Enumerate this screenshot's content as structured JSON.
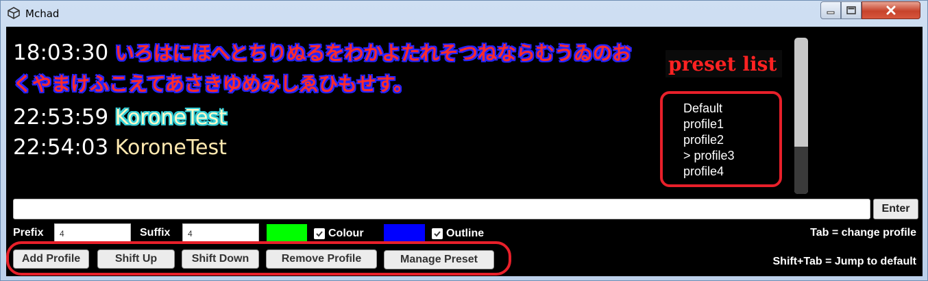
{
  "window": {
    "title": "Mchad"
  },
  "chat": [
    {
      "time": "18:03:30",
      "text": "いろはにほへとちりぬるをわかよたれそつねならむうゐのお",
      "style": "red"
    },
    {
      "time": "",
      "text": "くやまけふこえてあさきゆめみしゑひもせす。",
      "style": "red"
    },
    {
      "time": "22:53:59",
      "text": "KoroneTest",
      "style": "cyan"
    },
    {
      "time": "22:54:03",
      "text": "KoroneTest",
      "style": "plain"
    }
  ],
  "preset_panel": {
    "title": "preset list",
    "items": [
      "Default",
      "profile1",
      "profile2",
      "> profile3",
      "profile4"
    ]
  },
  "input": {
    "value": "",
    "enter_label": "Enter"
  },
  "settings": {
    "prefix_label": "Prefix",
    "prefix_value": "4",
    "suffix_label": "Suffix",
    "suffix_value": "4",
    "colour_label": "Colour",
    "colour_swatch": "#00ff00",
    "colour_checked": true,
    "outline_label": "Outline",
    "outline_swatch": "#0000ff",
    "outline_checked": true
  },
  "hints": {
    "tab": "Tab = change profile",
    "shift_tab": "Shift+Tab = Jump to default"
  },
  "buttons": {
    "add_profile": "Add Profile",
    "shift_up": "Shift Up",
    "shift_down": "Shift Down",
    "remove_profile": "Remove Profile",
    "manage_preset": "Manage Preset"
  },
  "colors": {
    "annotation_red": "#e8202a"
  }
}
